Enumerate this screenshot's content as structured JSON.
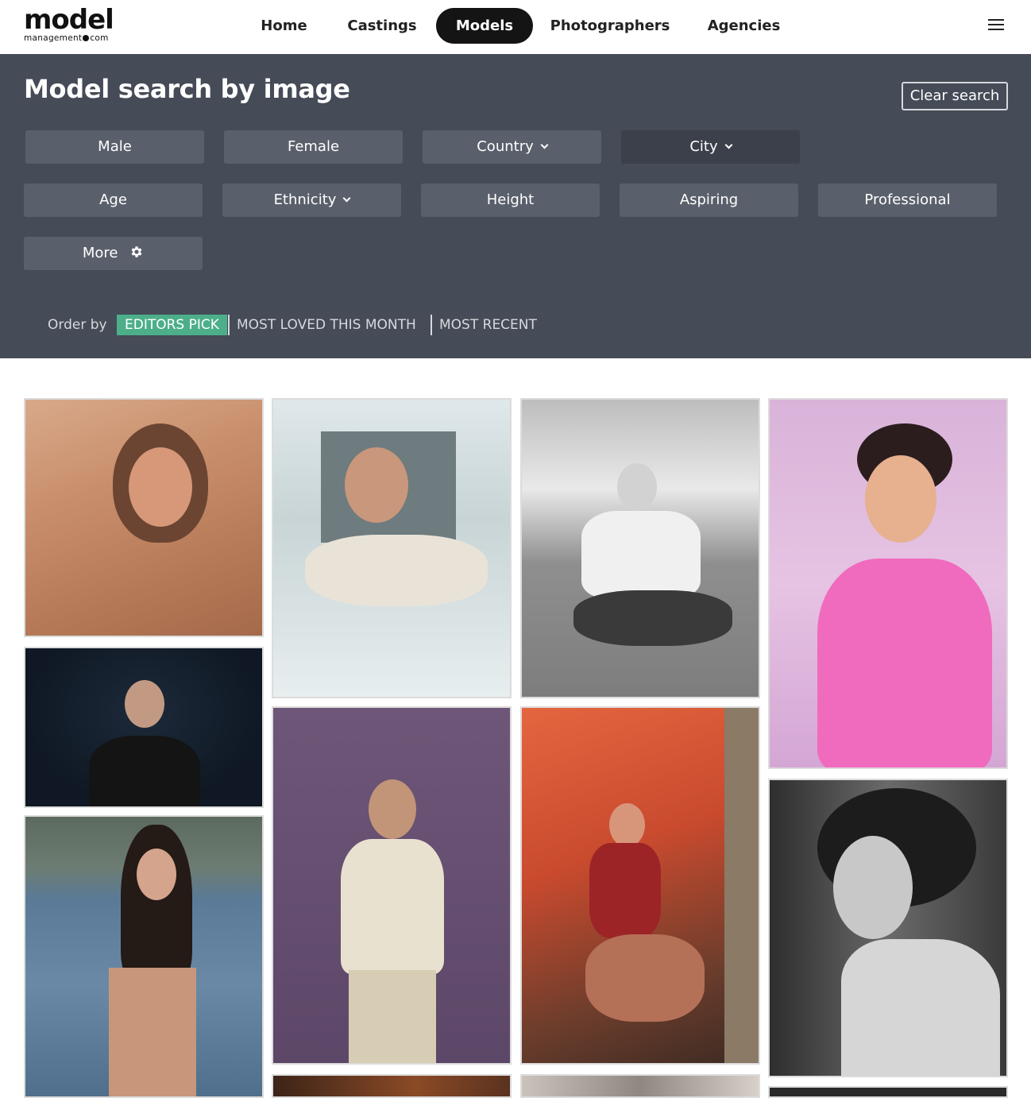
{
  "header": {
    "logo_main": "model",
    "logo_sub_left": "management",
    "logo_sub_right": "com",
    "nav": [
      "Home",
      "Castings",
      "Models",
      "Photographers",
      "Agencies"
    ],
    "active_nav": "Models"
  },
  "panel": {
    "title": "Model search by image",
    "clear_label": "Clear search",
    "filters_row1": [
      "Male",
      "Female",
      "Country",
      "City"
    ],
    "filters_row2": [
      "Age",
      "Ethnicity",
      "Height",
      "Aspiring",
      "Professional"
    ],
    "more_label": "More",
    "order_label": "Order by",
    "order_options": [
      "EDITORS PICK",
      "MOST LOVED THIS MONTH",
      "MOST RECENT"
    ],
    "order_active": "EDITORS PICK"
  },
  "colors": {
    "panel_bg": "#454b57",
    "filter_bg": "#5a606b",
    "accent_green": "#4caf8a",
    "nav_active_bg": "#141414"
  },
  "icons": {
    "menu": "hamburger-icon",
    "dropdown": "chevron-down-icon",
    "settings": "gear-icon"
  }
}
